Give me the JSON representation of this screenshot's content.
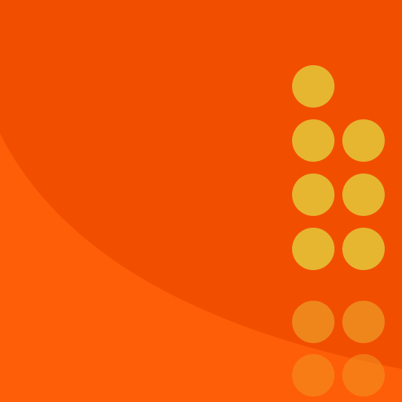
{
  "icon": {
    "name": "app-icon-dot-columns",
    "colors": {
      "background": "#F24E00",
      "glow": "#FF5E08",
      "dot": "#E6B630",
      "dot_faded": "#EE9020",
      "dot_fainter": "#F29622"
    },
    "dot_columns": {
      "left": {
        "solid": 4,
        "faded": 2
      },
      "right": {
        "solid": 3,
        "faded": 2
      }
    }
  }
}
